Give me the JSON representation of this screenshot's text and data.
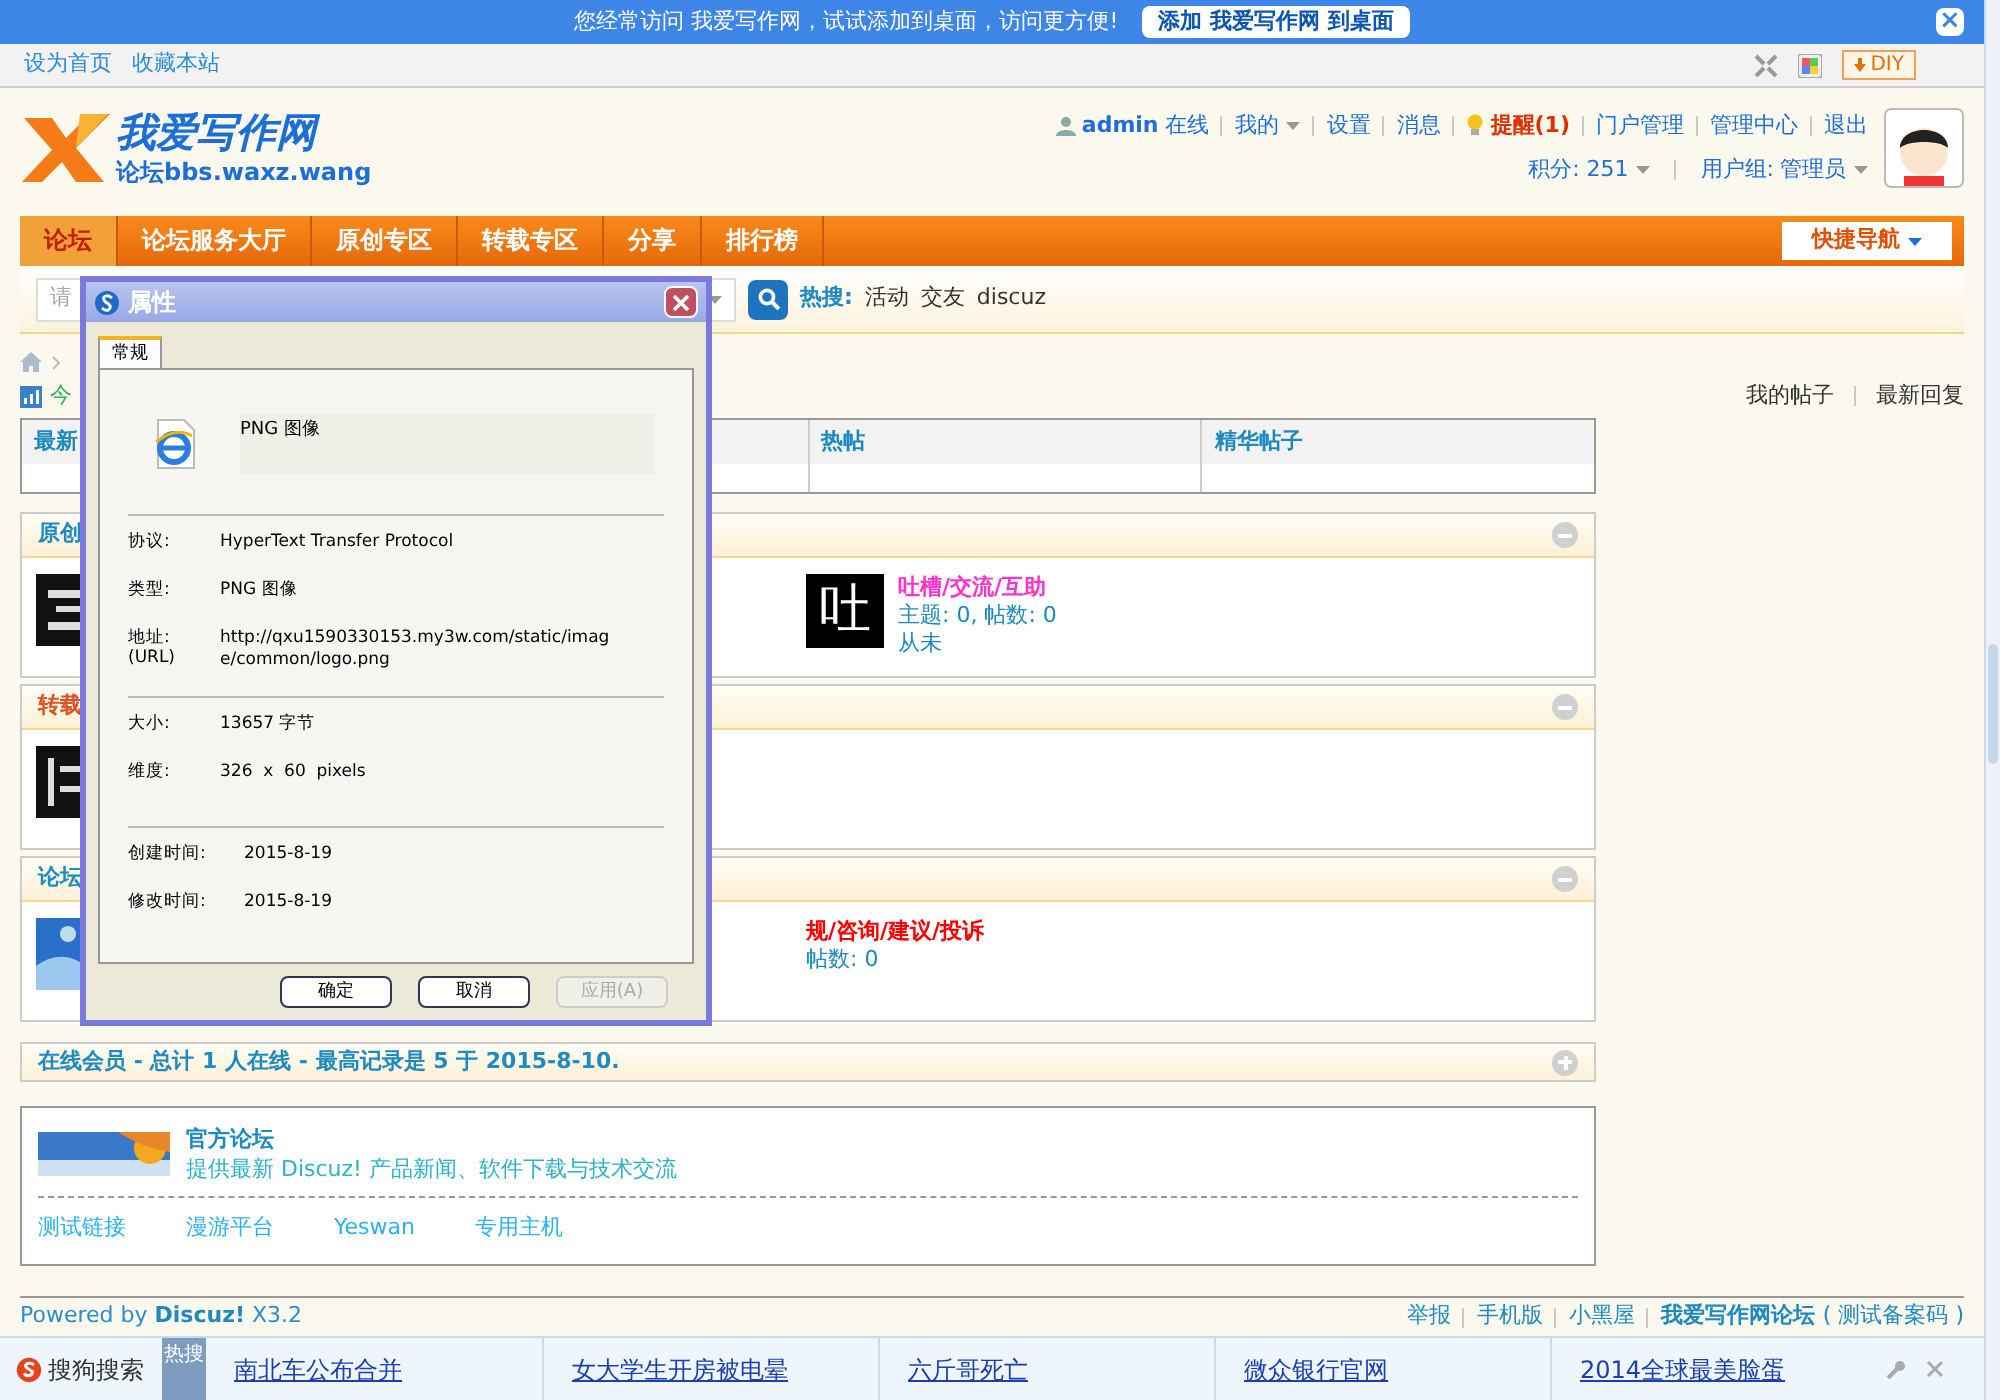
{
  "notice_bar": {
    "text": "您经常访问 我爱写作网，试试添加到桌面，访问更方便!",
    "button": "添加 我爱写作网 到桌面",
    "close": "×"
  },
  "topbar": {
    "links": [
      "设为首页",
      "收藏本站"
    ],
    "diy": "DIY"
  },
  "logo": {
    "title": "我爱写作网",
    "subtitle": "论坛bbs.waxz.wang"
  },
  "user_bar": {
    "username": "admin",
    "status": "在线",
    "links": [
      {
        "label": "我的",
        "kind": "menu"
      },
      {
        "label": "设置",
        "kind": "plain"
      },
      {
        "label": "消息",
        "kind": "plain"
      },
      {
        "label": "提醒(1)",
        "kind": "alert"
      },
      {
        "label": "门户管理",
        "kind": "plain"
      },
      {
        "label": "管理中心",
        "kind": "plain"
      },
      {
        "label": "退出",
        "kind": "plain"
      }
    ],
    "credits": "积分: 251",
    "group_label": "用户组:",
    "group_value": "管理员"
  },
  "nav": [
    {
      "label": "论坛",
      "selected": true
    },
    {
      "label": "论坛服务大厅",
      "selected": false
    },
    {
      "label": "原创专区",
      "selected": false
    },
    {
      "label": "转载专区",
      "selected": false
    },
    {
      "label": "分享",
      "selected": false
    },
    {
      "label": "排行榜",
      "selected": false
    }
  ],
  "quick_nav": "快捷导航",
  "search": {
    "placeholder": "请",
    "hot_label": "热搜:",
    "hot": [
      "活动",
      "交友",
      "discuz"
    ]
  },
  "stats": "今",
  "my_links": [
    "我的帖子",
    "最新回复"
  ],
  "post_table": {
    "columns": [
      "最新",
      "热帖",
      "精华帖子"
    ]
  },
  "sections": [
    {
      "title": "原创",
      "expanded": true,
      "forums": [
        {
          "name": "吐槽/交流/互助",
          "color": "#ff33cc",
          "char": "吐",
          "stats": "主题: 0, 帖数: 0",
          "last": "从未"
        }
      ]
    },
    {
      "title": "转载",
      "expanded": true
    },
    {
      "title": "论坛",
      "expanded": true,
      "forums": [
        {
          "name": "规/咨询/建议/投诉",
          "color": "#ff0000",
          "stats": "帖数: 0"
        }
      ]
    }
  ],
  "online": {
    "text": "在线会员 - 总计 1 人在线 - 最高记录是 5 于 2015-8-10.",
    "expanded": false
  },
  "friend_links": {
    "title": "官方论坛",
    "desc": "提供最新 Discuz! 产品新闻、软件下载与技术交流",
    "links": [
      "测试链接",
      "漫游平台",
      "Yeswan",
      "专用主机"
    ]
  },
  "footer": {
    "powered": "Powered by **Discuz!** X3.2",
    "links": [
      "举报",
      "手机版",
      "小黑屋",
      "我爱写作网论坛"
    ],
    "icp": "( 测试备案码 )"
  },
  "sogou_bar": {
    "brand": "搜狗搜索",
    "tag": "热搜",
    "items": [
      "南北车公布合并",
      "女大学生开房被电晕",
      "六斤哥死亡",
      "微众银行官网",
      "2014全球最美脸蛋"
    ]
  },
  "dialog": {
    "title": "属性",
    "tab": "常规",
    "file_type": "PNG 图像",
    "groups": [
      [
        {
          "label": "协议:",
          "value": "HyperText Transfer Protocol"
        },
        {
          "label": "类型:",
          "value": "PNG 图像"
        },
        {
          "label": "地址:",
          "sublabel": "(URL)",
          "value": "http://qxu1590330153.my3w.com/static/image/common/logo.png"
        }
      ],
      [
        {
          "label": "大小:",
          "value": "13657 字节"
        },
        {
          "label": "维度:",
          "value": "326  x  60  pixels"
        }
      ],
      [
        {
          "label": "创建时间:",
          "value": "2015-8-19"
        },
        {
          "label": "修改时间:",
          "value": "2015-8-19"
        }
      ]
    ],
    "buttons": [
      {
        "label": "确定",
        "disabled": false
      },
      {
        "label": "取消",
        "disabled": false
      },
      {
        "label": "应用(A)",
        "disabled": true
      }
    ]
  }
}
